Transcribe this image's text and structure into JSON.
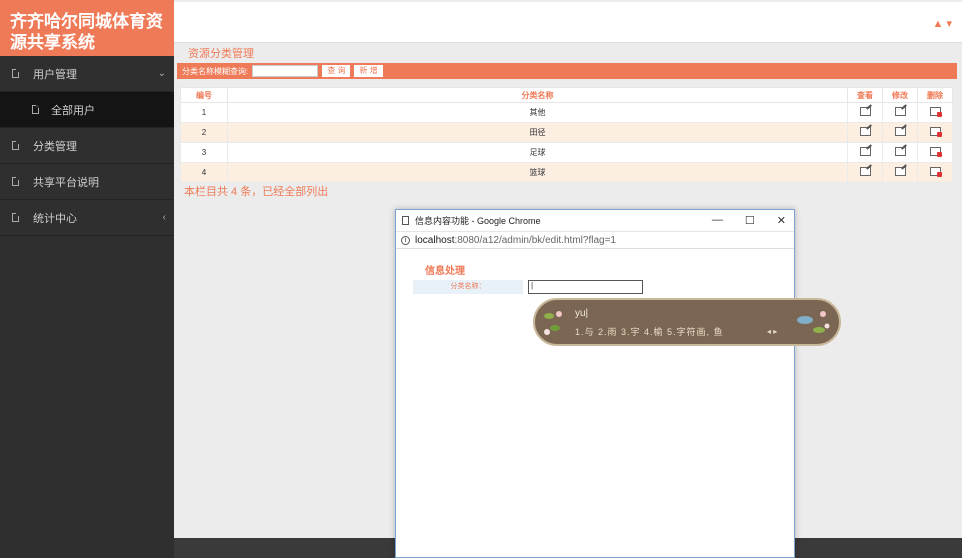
{
  "app": {
    "brand_line1": "齐齐哈尔同城体育资",
    "brand_line2": "源共享系统"
  },
  "sidebar": {
    "items": [
      {
        "label": "用户管理",
        "arrow": "⌄"
      },
      {
        "label": "全部用户"
      },
      {
        "label": "分类管理"
      },
      {
        "label": "共享平台说明"
      },
      {
        "label": "统计中心",
        "arrow": "‹"
      }
    ]
  },
  "topbar": {
    "user_icon": "▲ ▾"
  },
  "main": {
    "title": "资源分类管理",
    "search_label": "分类名称模糊查询:",
    "search_value": "",
    "query_button": "查 询",
    "new_button": "新 增",
    "table": {
      "headers": [
        "编号",
        "分类名称",
        "查看",
        "修改",
        "删除"
      ],
      "rows": [
        {
          "id": "1",
          "name": "其他"
        },
        {
          "id": "2",
          "name": "田径"
        },
        {
          "id": "3",
          "name": "足球"
        },
        {
          "id": "4",
          "name": "篮球"
        }
      ]
    },
    "summary": "本栏目共 4 条，已经全部列出"
  },
  "popup": {
    "window_title": "信息内容功能 - Google Chrome",
    "min": "—",
    "max": "☐",
    "close": "✕",
    "url_host": "localhost",
    "url_path": ":8080/a12/admin/bk/edit.html?flag=1",
    "form_title": "信息处理",
    "field_label": "分类名称：",
    "field_value": "|"
  },
  "ime": {
    "pinyin": "yu|",
    "candidates": "1.与  2.雨  3.宇  4.榆  5.字符画, 鱼",
    "nav": "◂ ▸"
  }
}
